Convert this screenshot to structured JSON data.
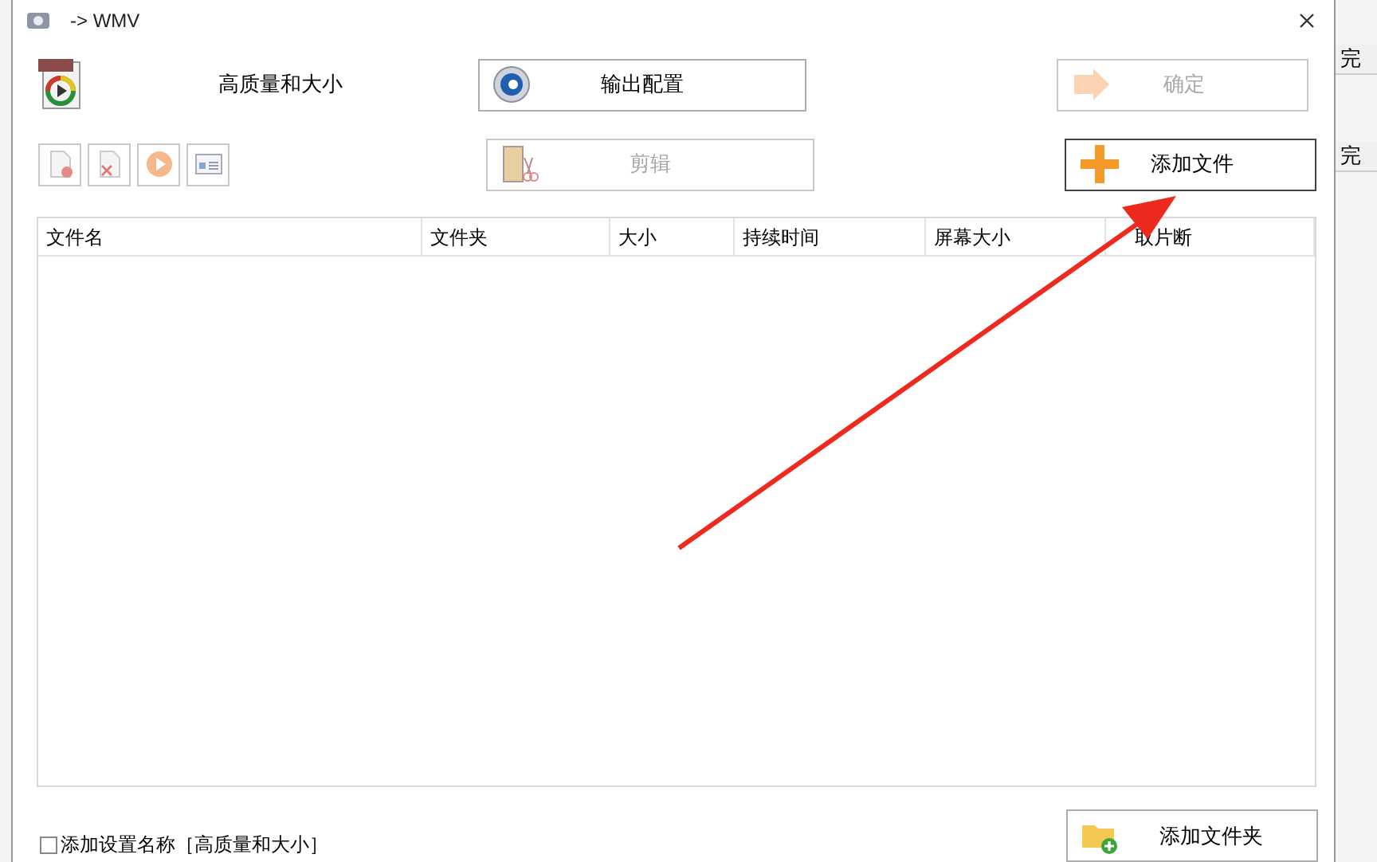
{
  "window": {
    "title": "-> WMV"
  },
  "preset": {
    "name": "高质量和大小"
  },
  "buttons": [
    {
      "kind": "config",
      "label": "输出配置",
      "disabled": false
    },
    {
      "kind": "ok",
      "label": "确定",
      "disabled": true
    },
    {
      "kind": "cut",
      "label": "剪辑",
      "disabled": true
    },
    {
      "kind": "add",
      "label": "添加文件",
      "disabled": false
    }
  ],
  "table": {
    "columns": [
      "文件名",
      "文件夹",
      "大小",
      "持续时间",
      "屏幕大小",
      "取片断"
    ]
  },
  "footer": {
    "checkbox": {
      "label": "添加设置名称［高质量和大小］",
      "checked": false
    },
    "folder_button": {
      "label": "添加文件夹"
    }
  },
  "background_list": {
    "items": [
      "完",
      "完"
    ]
  }
}
